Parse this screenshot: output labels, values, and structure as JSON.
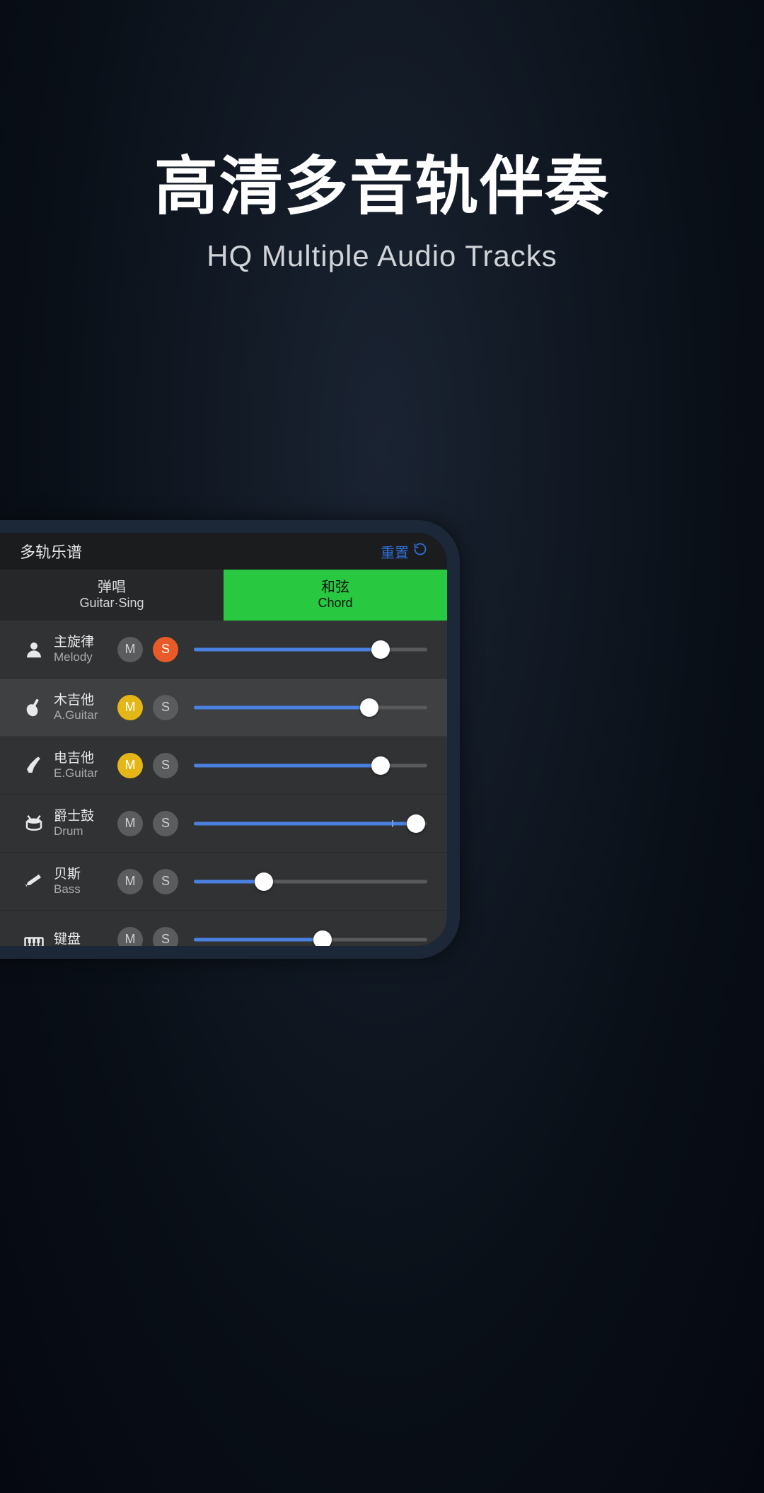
{
  "headline": "高清多音轨伴奏",
  "subhead": "HQ Multiple Audio Tracks",
  "titlebar": {
    "title": "多轨乐谱",
    "reset": "重置"
  },
  "tabs": {
    "left": {
      "zh": "弹唱",
      "en": "Guitar·Sing"
    },
    "right": {
      "zh": "和弦",
      "en": "Chord"
    }
  },
  "buttons": {
    "mute": "M",
    "solo": "S"
  },
  "tracks": [
    {
      "zh": "主旋律",
      "en": "Melody",
      "icon": "person",
      "mute": "gray",
      "solo": "orange",
      "value": 80,
      "selected": false
    },
    {
      "zh": "木吉他",
      "en": "A.Guitar",
      "icon": "aguitar",
      "mute": "yellow",
      "solo": "gray",
      "value": 75,
      "selected": true
    },
    {
      "zh": "电吉他",
      "en": "E.Guitar",
      "icon": "eguitar",
      "mute": "yellow",
      "solo": "gray",
      "value": 80,
      "selected": false
    },
    {
      "zh": "爵士鼓",
      "en": "Drum",
      "icon": "drum",
      "mute": "gray",
      "solo": "gray",
      "value": 95,
      "tick": 85,
      "selected": false
    },
    {
      "zh": "贝斯",
      "en": "Bass",
      "icon": "bass",
      "mute": "gray",
      "solo": "gray",
      "value": 30,
      "selected": false
    },
    {
      "zh": "键盘",
      "en": "",
      "icon": "piano",
      "mute": "gray",
      "solo": "gray",
      "value": 55,
      "selected": false
    }
  ]
}
